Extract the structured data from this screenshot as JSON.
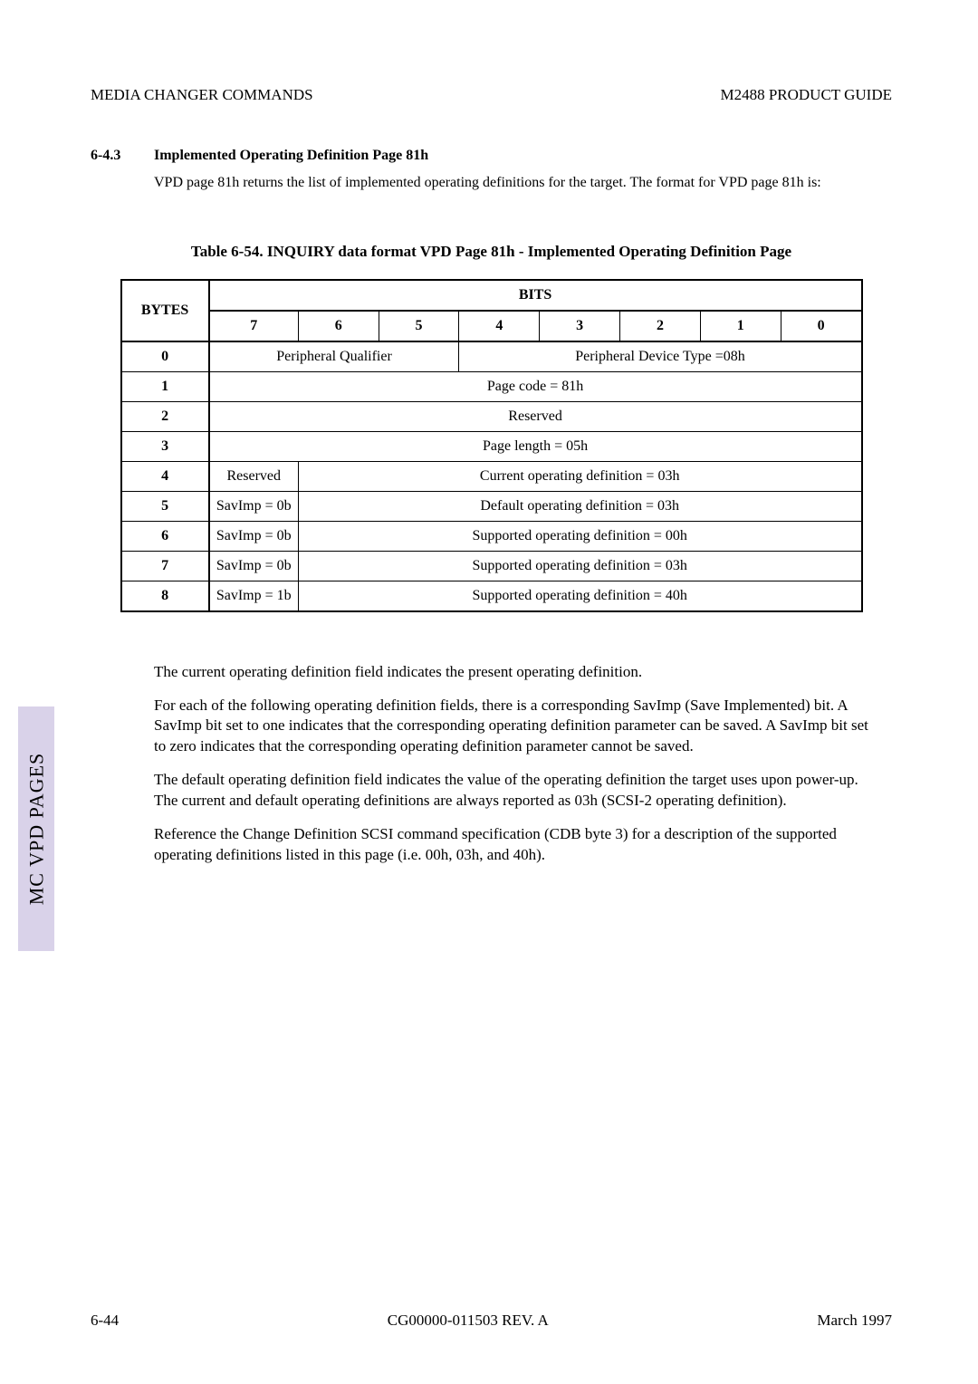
{
  "header": {
    "left": "MEDIA CHANGER COMMANDS",
    "right": "M2488 PRODUCT GUIDE"
  },
  "section": {
    "num": "6-4.3",
    "title": "Implemented Operating Definition Page 81h",
    "intro": "VPD page 81h returns the list of implemented operating definitions for the target. The format for VPD page 81h is:"
  },
  "table": {
    "caption": "Table 6-54.   INQUIRY data format VPD Page 81h - Implemented Operating Definition Page",
    "bits_label": "BITS",
    "bytes_label": "BYTES",
    "bit_cols": [
      "7",
      "6",
      "5",
      "4",
      "3",
      "2",
      "1",
      "0"
    ],
    "rows": [
      {
        "byte": "0",
        "cells": [
          {
            "span": 3,
            "text": "Peripheral Qualifier"
          },
          {
            "span": 5,
            "text": "Peripheral Device Type =08h"
          }
        ]
      },
      {
        "byte": "1",
        "cells": [
          {
            "span": 8,
            "text": "Page code  =  81h"
          }
        ]
      },
      {
        "byte": "2",
        "cells": [
          {
            "span": 8,
            "text": "Reserved"
          }
        ]
      },
      {
        "byte": "3",
        "cells": [
          {
            "span": 8,
            "text": "Page length  = 05h"
          }
        ]
      },
      {
        "byte": "4",
        "cells": [
          {
            "span": 1,
            "text": "Reserved"
          },
          {
            "span": 7,
            "text": "Current operating definition = 03h"
          }
        ]
      },
      {
        "byte": "5",
        "cells": [
          {
            "span": 1,
            "text": "SavImp = 0b"
          },
          {
            "span": 7,
            "text": "Default operating definition = 03h"
          }
        ]
      },
      {
        "byte": "6",
        "cells": [
          {
            "span": 1,
            "text": "SavImp = 0b"
          },
          {
            "span": 7,
            "text": "Supported operating definition = 00h"
          }
        ]
      },
      {
        "byte": "7",
        "cells": [
          {
            "span": 1,
            "text": "SavImp = 0b"
          },
          {
            "span": 7,
            "text": "Supported operating definition = 03h"
          }
        ]
      },
      {
        "byte": "8",
        "cells": [
          {
            "span": 1,
            "text": "SavImp = 1b"
          },
          {
            "span": 7,
            "text": "Supported operating definition = 40h"
          }
        ]
      }
    ]
  },
  "paragraphs": [
    "The current operating definition field indicates the present operating definition.",
    "For each of the following operating definition fields, there is a corresponding SavImp (Save Implemented) bit.  A SavImp bit set to one indicates that the corresponding operating definition parameter can be saved.  A SavImp bit set to zero indicates that the corresponding operating definition parameter cannot be saved.",
    "The default operating definition field indicates the value of the operating definition the target uses upon power-up.  The current and default operating definitions are always reported as 03h (SCSI-2 operating definition).",
    "Reference the Change Definition SCSI command specification (CDB byte 3) for a description of the supported operating definitions listed in this page (i.e. 00h, 03h, and 40h)."
  ],
  "sidetab": "MC VPD PAGES",
  "footer": {
    "left": "6-44",
    "center": "CG00000-011503 REV. A",
    "right": "March 1997"
  }
}
